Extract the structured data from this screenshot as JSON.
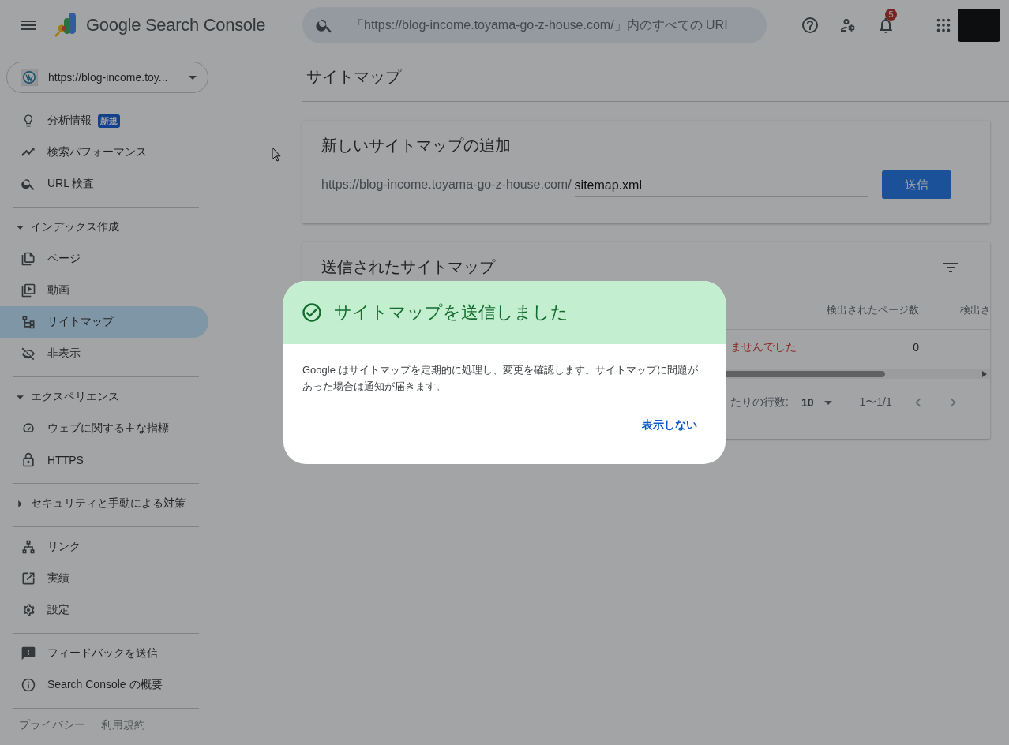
{
  "header": {
    "product": "Google Search Console",
    "search": {
      "placeholder": "「https://blog-income.toyama-go-z-house.com/」内のすべての URI"
    },
    "notifications": "5"
  },
  "property_selector": {
    "value": "https://blog-income.toy..."
  },
  "sidebar": {
    "sections": [
      {
        "items": [
          {
            "label": "分析情報",
            "badge": "新規",
            "selected": false
          },
          {
            "label": "検索パフォーマンス",
            "selected": false
          },
          {
            "label": "URL 検査",
            "selected": false
          }
        ]
      },
      {
        "heading": "インデックス作成",
        "expanded": true,
        "items": [
          {
            "label": "ページ",
            "selected": false
          },
          {
            "label": "動画",
            "selected": false
          },
          {
            "label": "サイトマップ",
            "selected": true
          },
          {
            "label": "非表示",
            "selected": false
          }
        ]
      },
      {
        "heading": "エクスペリエンス",
        "expanded": true,
        "items": [
          {
            "label": "ウェブに関する主な指標",
            "selected": false
          },
          {
            "label": "HTTPS",
            "selected": false
          }
        ]
      },
      {
        "heading": "セキュリティと手動による対策",
        "expanded": false
      },
      {
        "items": [
          {
            "label": "リンク",
            "selected": false
          },
          {
            "label": "実績",
            "selected": false
          },
          {
            "label": "設定",
            "selected": false
          }
        ]
      },
      {
        "items": [
          {
            "label": "フィードバックを送信",
            "selected": false
          },
          {
            "label": "Search Console の概要",
            "selected": false
          }
        ]
      }
    ],
    "footer_links": [
      "プライバシー",
      "利用規約"
    ]
  },
  "page_title": "サイトマップ",
  "add_card": {
    "title": "新しいサイトマップの追加",
    "url_prefix": "https://blog-income.toyama-go-z-house.com/",
    "input_value": "sitemap.xml",
    "submit": "送信"
  },
  "submitted_card": {
    "title": "送信されたサイトマップ",
    "columns": [
      "検出されたページ数",
      "検出さ"
    ],
    "rows": [
      {
        "status": "ませんでした",
        "pages": "0"
      }
    ],
    "rows_per_page_label": "たりの行数:",
    "rows_per_page": "10",
    "range": "1〜1/1"
  },
  "dialog": {
    "title": "サイトマップを送信しました",
    "body": "Google はサイトマップを定期的に処理し、変更を確認します。サイトマップに問題があった場合は通知が届きます。",
    "action": "表示しない"
  }
}
